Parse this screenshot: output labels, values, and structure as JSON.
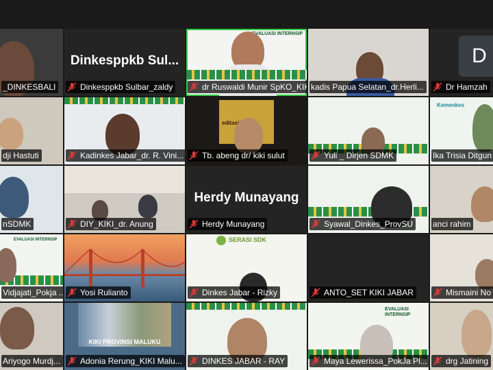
{
  "participants": [
    {
      "name": "_DINKESBALI"
    },
    {
      "name": "Dinkesppkb Sulbar_zaldy",
      "big_label": "Dinkesppkb  Sul..."
    },
    {
      "name": "dr Ruswaldi Munir SpKO_KIK..."
    },
    {
      "name": "kadis Papua Selatan_dr.Herli..."
    },
    {
      "name": "Dr Hamzah",
      "big_label": "D"
    },
    {
      "name": "dji Hastuti"
    },
    {
      "name": "Kadinkes Jabar_dr. R. Vini..."
    },
    {
      "name": "Tb. abeng dr/ kiki sulut"
    },
    {
      "name": "Yuli _ Dirjen SDMK"
    },
    {
      "name": "Ika Trisia Ditgun"
    },
    {
      "name": "nSDMK"
    },
    {
      "name": "DIY_KIKI_dr. Anung"
    },
    {
      "name": "Herdy Munayang",
      "big_label": "Herdy Munayang"
    },
    {
      "name": "Syawal_Dinkes_ProvSU"
    },
    {
      "name": "anci rahim"
    },
    {
      "name": "Vidjajati_Pokja ..."
    },
    {
      "name": "Yosi Rulianto"
    },
    {
      "name": "Dinkes Jabar - Rizky"
    },
    {
      "name": "ANTO_SET KIKI JABAR"
    },
    {
      "name": "Mismaini No"
    },
    {
      "name": "Ariyogo Murdj..."
    },
    {
      "name": "Adonia Rerung_KIKI Malu..."
    },
    {
      "name": "DINKES JABAR - RAY"
    },
    {
      "name": "Maya Lewerissa_PokJa Pl..."
    },
    {
      "name": "drg Jatining"
    }
  ],
  "backgrounds": {
    "evaluasi": "EVALUASI INTERNSIP",
    "serasi": "SERASI SDK",
    "kemenkes": "Kemenkes",
    "maluku": "KIKI PROVINSI MALUKU",
    "meditasi": "editasi R"
  },
  "colors": {
    "active_border": "#2ecc40",
    "mute_icon": "#e03a3a",
    "namebar_bg": "#000000b8"
  }
}
